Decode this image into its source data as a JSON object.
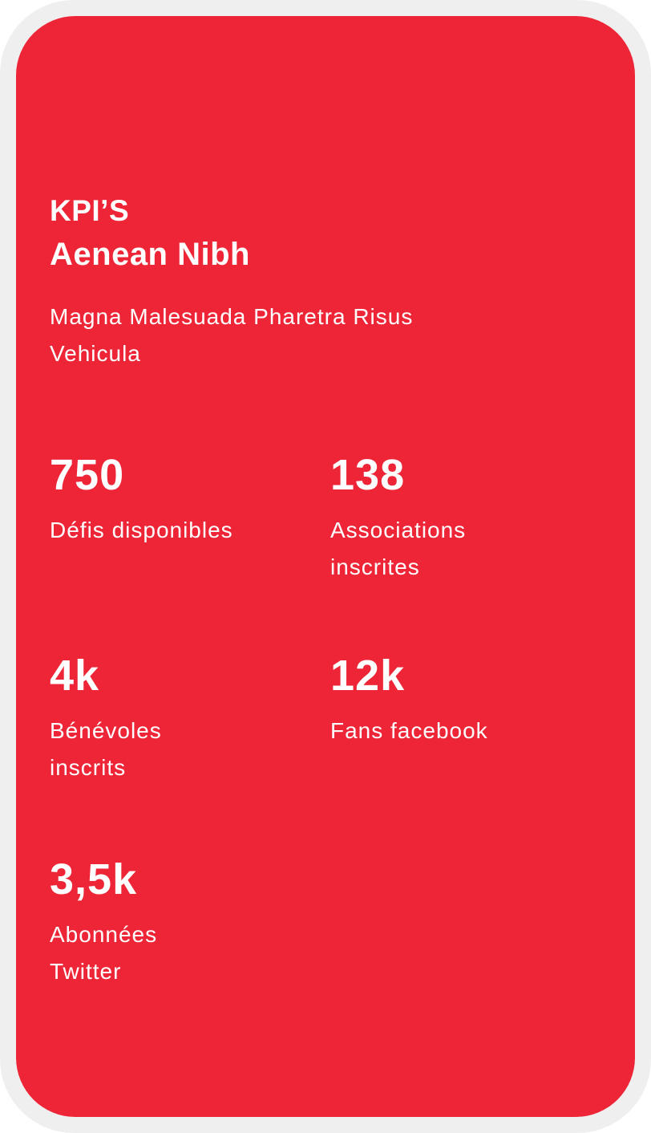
{
  "colors": {
    "frame": "#efefef",
    "card_background": "#ee2536",
    "text": "#ffffff"
  },
  "header": {
    "kicker": "KPI’S",
    "title": "Aenean Nibh",
    "subtitle": "Magna Malesuada Pharetra Risus Vehicula"
  },
  "stats": [
    {
      "value": "750",
      "label": "Défis disponibles"
    },
    {
      "value": "138",
      "label": "Associations inscrites"
    },
    {
      "value": "4k",
      "label": "Bénévoles inscrits"
    },
    {
      "value": "12k",
      "label": "Fans facebook"
    },
    {
      "value": "3,5k",
      "label": "Abonnées Twitter"
    }
  ]
}
